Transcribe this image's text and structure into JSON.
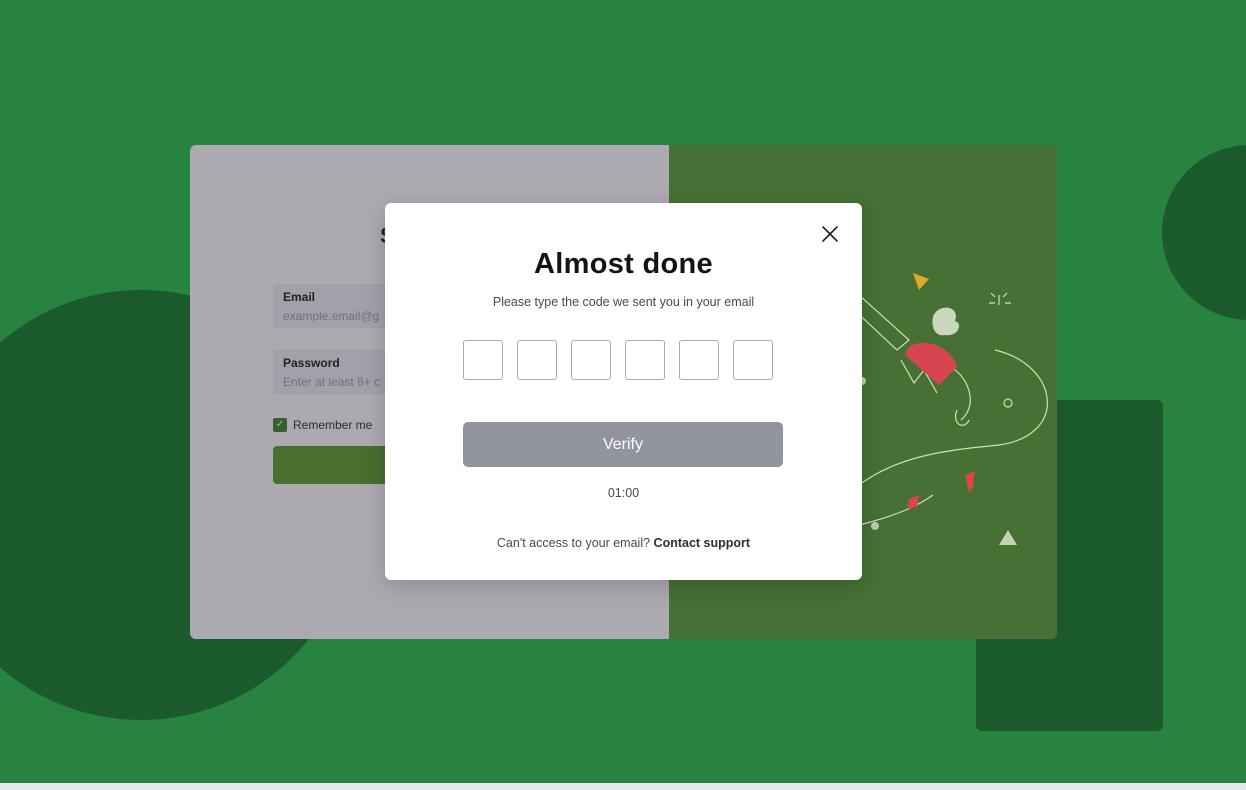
{
  "background": {
    "color": "#268440",
    "shape_color": "#1b5a2c"
  },
  "signin_form": {
    "title": "S",
    "email_label": "Email",
    "email_placeholder": "example.email@g",
    "password_label": "Password",
    "password_placeholder": "Enter at least 8+ c",
    "remember_label": "Remember me",
    "remember_checked": true,
    "accent_color": "#5ea12f"
  },
  "modal": {
    "title": "Almost done",
    "subtitle": "Please type the code we sent you in your email",
    "code_digits": [
      "",
      "",
      "",
      "",
      "",
      ""
    ],
    "verify_label": "Verify",
    "timer": "01:00",
    "support_prompt": "Can't access to your email?",
    "support_link": "Contact support",
    "close_icon": "close-icon"
  },
  "colors": {
    "verify_button": "#92959f",
    "illustration_accent_red": "#d64550",
    "illustration_accent_yellow": "#e3a82b"
  }
}
